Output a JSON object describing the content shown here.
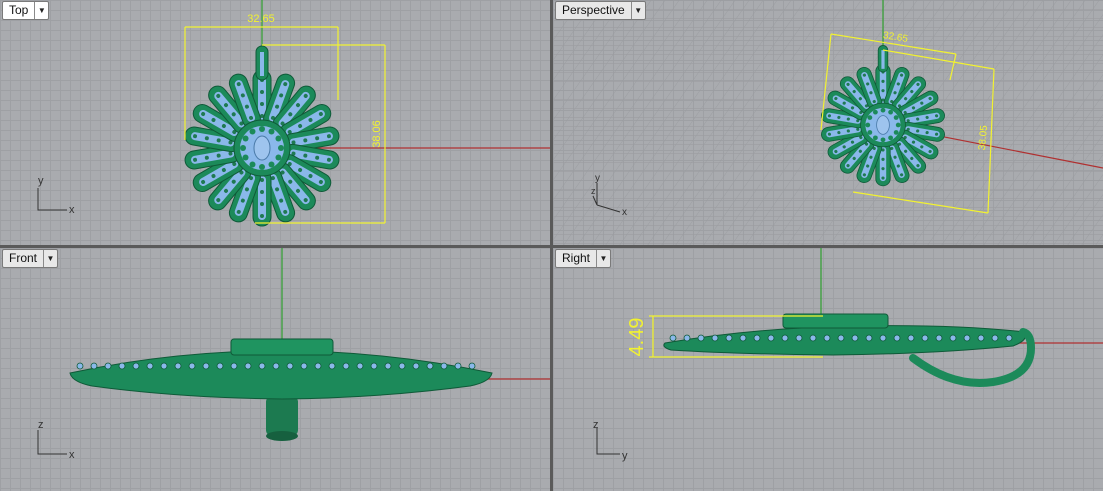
{
  "viewports": {
    "top": {
      "label": "Top",
      "dims": {
        "width": "32.65",
        "height": "38.06"
      },
      "axes": {
        "a": "y",
        "b": "x"
      }
    },
    "perspective": {
      "label": "Perspective",
      "dims": {
        "width": "32.65",
        "height": "38.05"
      },
      "axes": {
        "a": "y",
        "b": "z",
        "c": "x"
      }
    },
    "front": {
      "label": "Front",
      "axes": {
        "a": "z",
        "b": "x"
      }
    },
    "right": {
      "label": "Right",
      "dims": {
        "thickness": "4.49"
      },
      "axes": {
        "a": "z",
        "b": "y"
      }
    }
  },
  "colors": {
    "grid_bg": "#a9abaf",
    "model_green": "#1c8a5a",
    "model_blue": "#8ab8ea",
    "dimension": "#f2f230",
    "x_axis": "#b03030",
    "y_axis": "#30a030"
  }
}
